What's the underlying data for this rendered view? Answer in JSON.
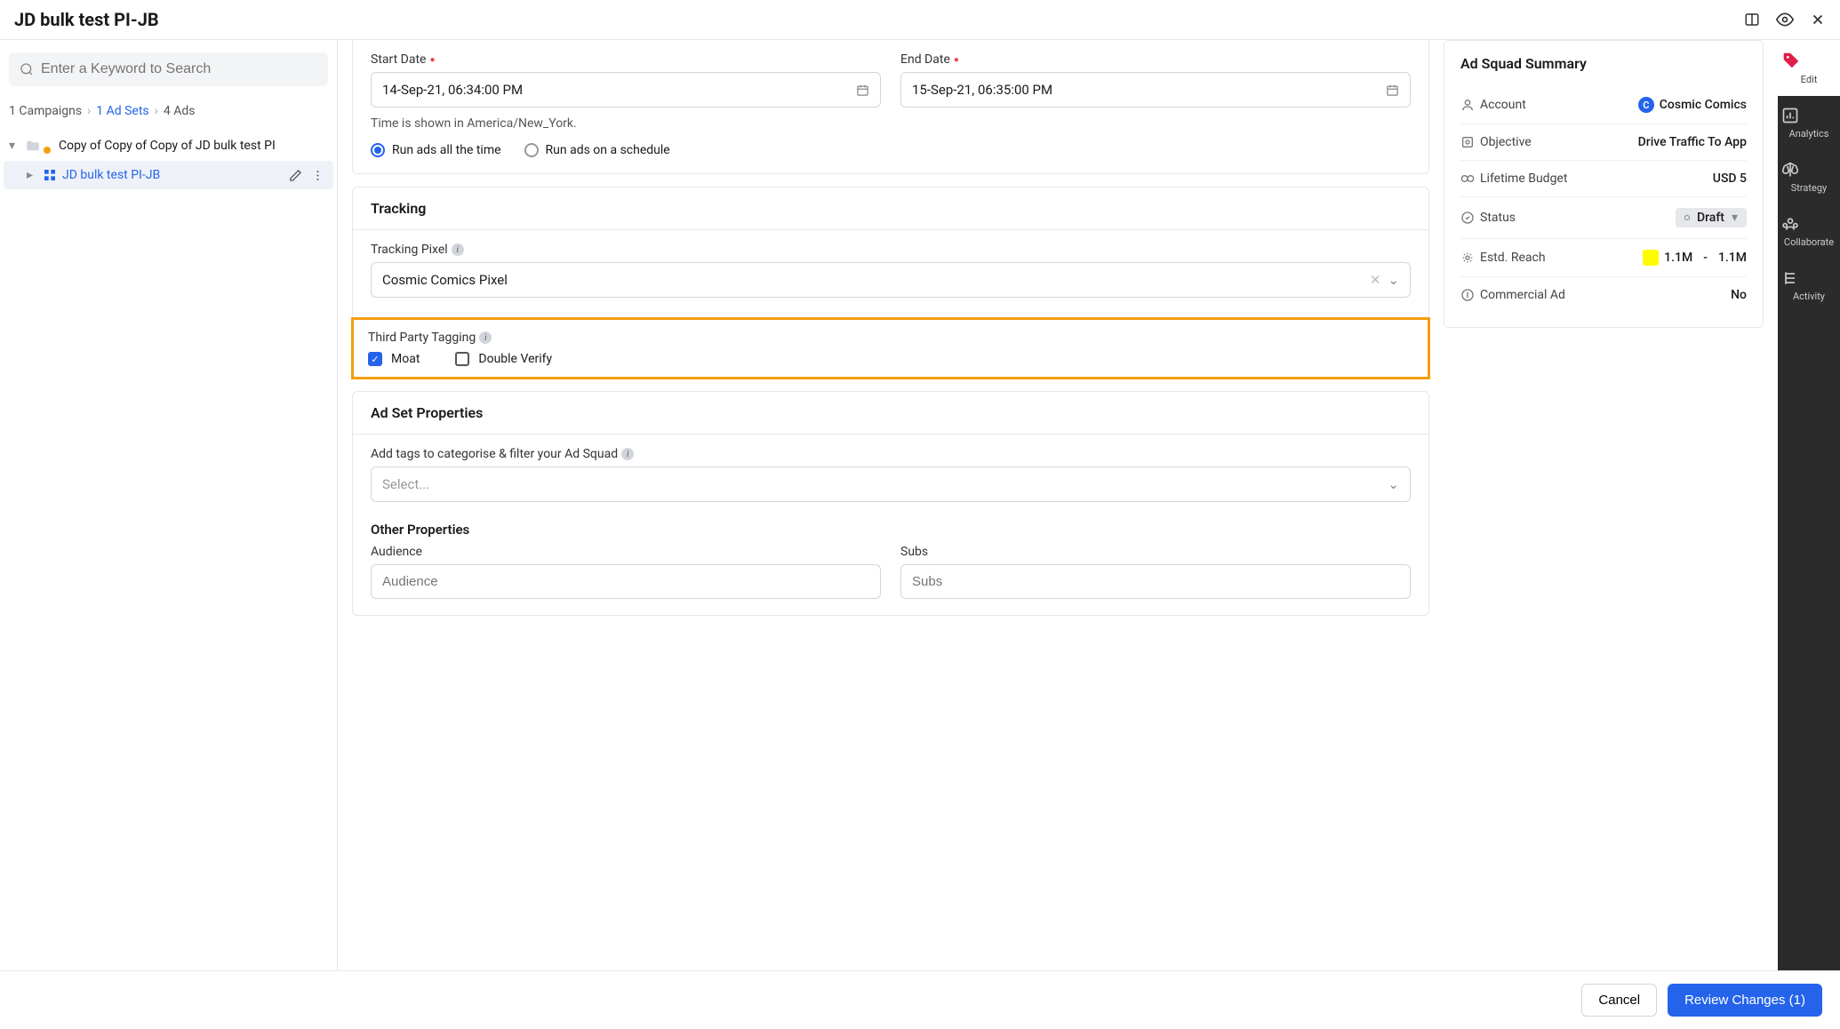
{
  "header": {
    "title": "JD bulk test PI-JB"
  },
  "sidebar": {
    "search_placeholder": "Enter a Keyword to Search",
    "breadcrumbs": {
      "campaigns": "1 Campaigns",
      "adsets": "1 Ad Sets",
      "ads": "4 Ads"
    },
    "tree": {
      "campaign_name": "Copy of Copy of Copy of JD bulk test PI",
      "adset_name": "JD bulk test PI-JB"
    }
  },
  "form": {
    "dates": {
      "start_label": "Start Date",
      "end_label": "End Date",
      "start_value": "14-Sep-21, 06:34:00 PM",
      "end_value": "15-Sep-21, 06:35:00 PM",
      "tz_hint": "Time is shown in America/New_York."
    },
    "schedule": {
      "run_all": "Run ads all the time",
      "run_schedule": "Run ads on a schedule"
    },
    "tracking": {
      "title": "Tracking",
      "pixel_label": "Tracking Pixel",
      "pixel_value": "Cosmic Comics Pixel",
      "third_party_label": "Third Party Tagging",
      "moat": "Moat",
      "double_verify": "Double Verify"
    },
    "adset_props": {
      "title": "Ad Set Properties",
      "tags_label": "Add tags to categorise & filter your Ad Squad",
      "tags_placeholder": "Select...",
      "other_title": "Other Properties",
      "audience_label": "Audience",
      "audience_placeholder": "Audience",
      "subs_label": "Subs",
      "subs_placeholder": "Subs"
    }
  },
  "summary": {
    "title": "Ad Squad Summary",
    "rows": {
      "account": {
        "label": "Account",
        "value": "Cosmic Comics",
        "initial": "C"
      },
      "objective": {
        "label": "Objective",
        "value": "Drive Traffic To App"
      },
      "budget": {
        "label": "Lifetime Budget",
        "value": "USD 5"
      },
      "status": {
        "label": "Status",
        "value": "Draft"
      },
      "reach": {
        "label": "Estd. Reach",
        "low": "1.1M",
        "dash": "-",
        "high": "1.1M"
      },
      "commercial": {
        "label": "Commercial Ad",
        "value": "No"
      }
    }
  },
  "rail": {
    "edit": "Edit",
    "analytics": "Analytics",
    "strategy": "Strategy",
    "collaborate": "Collaborate",
    "activity": "Activity"
  },
  "footer": {
    "cancel": "Cancel",
    "review": "Review Changes (1)"
  }
}
